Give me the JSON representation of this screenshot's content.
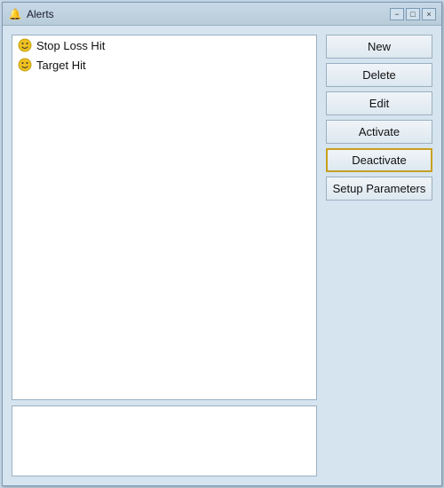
{
  "window": {
    "title": "Alerts",
    "icon": "🔔"
  },
  "titlebar": {
    "minimize_label": "−",
    "restore_label": "□",
    "close_label": "×"
  },
  "list": {
    "items": [
      {
        "label": "Stop Loss Hit",
        "icon": "smiley"
      },
      {
        "label": "Target Hit",
        "icon": "smiley"
      }
    ]
  },
  "buttons": {
    "new_label": "New",
    "delete_label": "Delete",
    "edit_label": "Edit",
    "activate_label": "Activate",
    "deactivate_label": "Deactivate",
    "setup_label": "Setup Parameters"
  }
}
